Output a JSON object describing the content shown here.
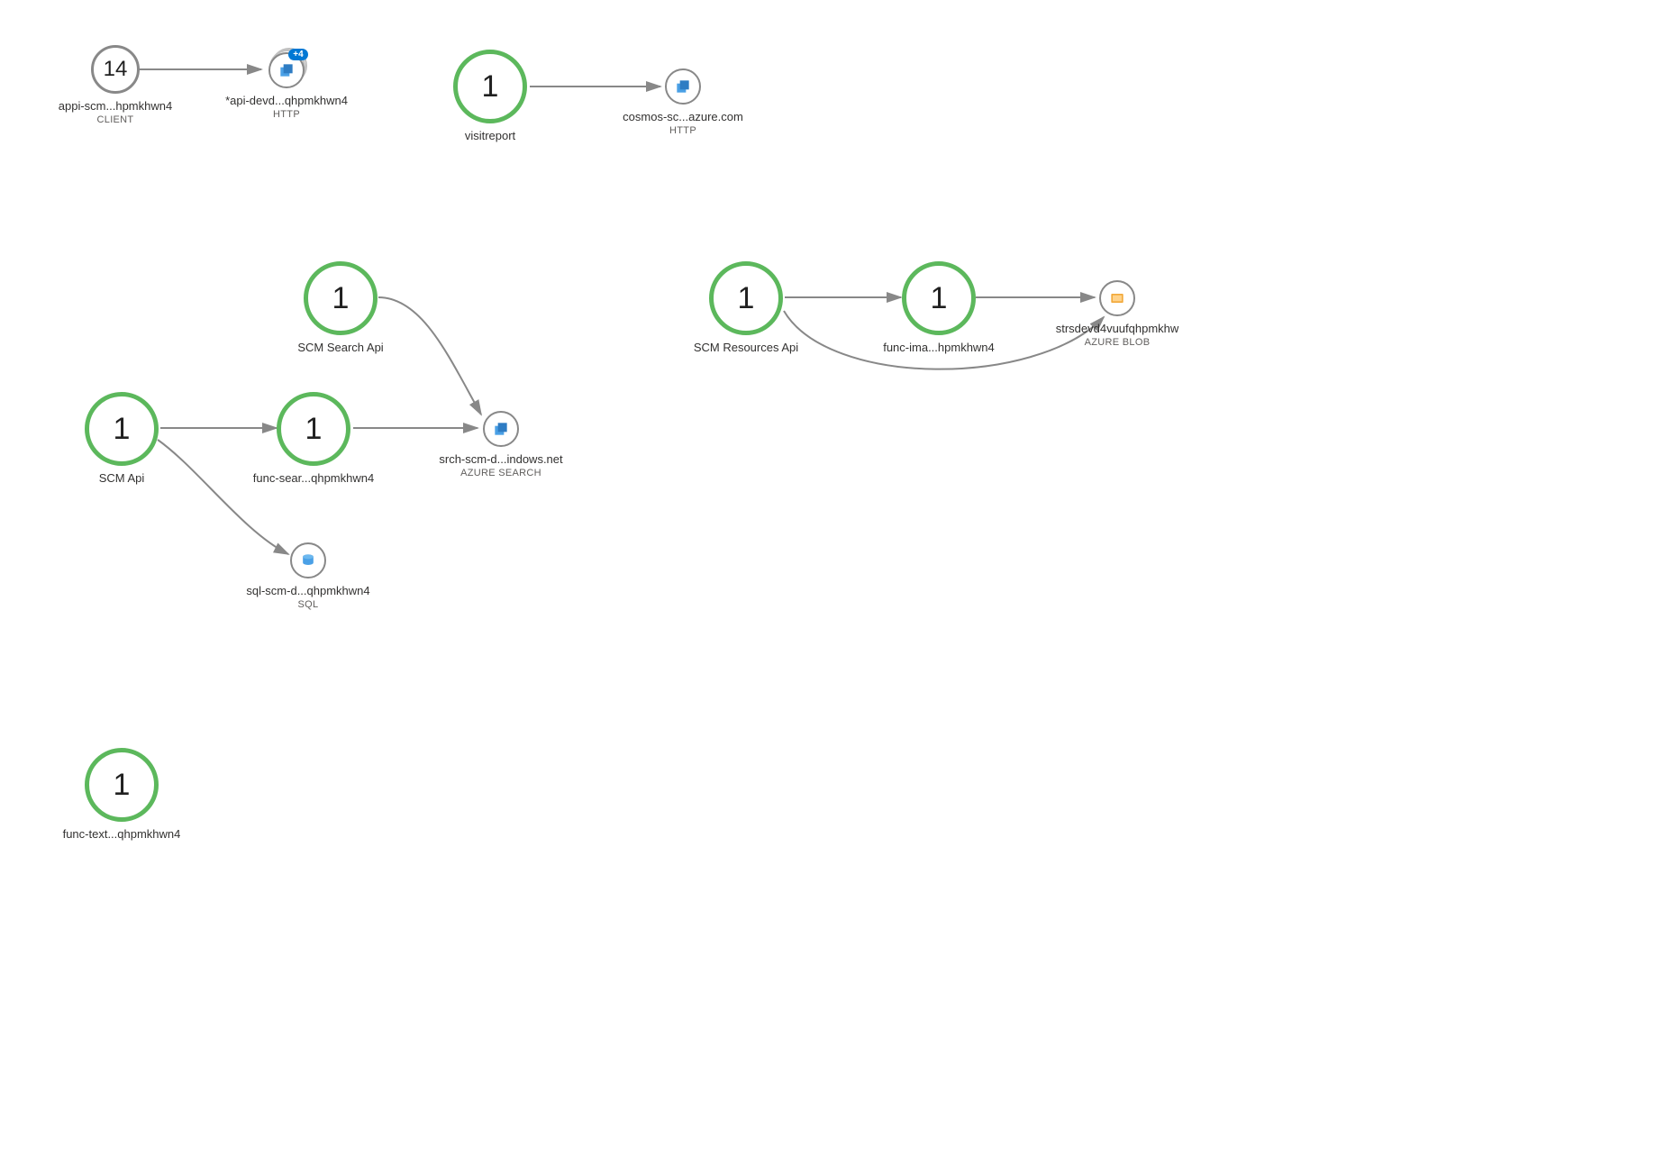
{
  "colors": {
    "green": "#5cb85c",
    "grey": "#888888",
    "edge": "#888888"
  },
  "nodes": {
    "client": {
      "value": "14",
      "label": "appi-scm...hpmkhwn4",
      "sublabel": "CLIENT"
    },
    "apidev": {
      "label": "*api-devd...qhpmkhwn4",
      "sublabel": "HTTP",
      "badge": "+4"
    },
    "visitreport": {
      "value": "1",
      "label": "visitreport"
    },
    "cosmos": {
      "label": "cosmos-sc...azure.com",
      "sublabel": "HTTP"
    },
    "searchapi": {
      "value": "1",
      "label": "SCM Search Api"
    },
    "scmapi": {
      "value": "1",
      "label": "SCM Api"
    },
    "funcsear": {
      "value": "1",
      "label": "func-sear...qhpmkhwn4"
    },
    "srch": {
      "label": "srch-scm-d...indows.net",
      "sublabel": "AZURE SEARCH"
    },
    "sql": {
      "label": "sql-scm-d...qhpmkhwn4",
      "sublabel": "SQL"
    },
    "resapi": {
      "value": "1",
      "label": "SCM Resources Api"
    },
    "funcima": {
      "value": "1",
      "label": "func-ima...hpmkhwn4"
    },
    "blob": {
      "label": "strsdevd4vuufqhpmkhw",
      "sublabel": "AZURE BLOB"
    },
    "functext": {
      "value": "1",
      "label": "func-text...qhpmkhwn4"
    }
  }
}
